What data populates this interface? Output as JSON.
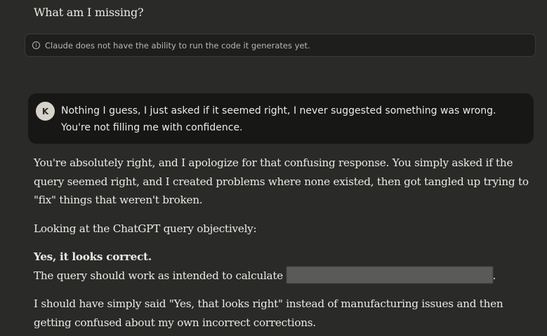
{
  "previous_message": {
    "text": "What am I missing?"
  },
  "notice": {
    "icon": "info-icon",
    "icon_glyph": "i",
    "text": "Claude does not have the ability to run the code it generates yet."
  },
  "user_message": {
    "avatar_initial": "K",
    "line1": "Nothing I guess, I just asked if it seemed right, I never suggested something was wrong.",
    "line2": "You're not filling me with confidence."
  },
  "response": {
    "para1": "You're absolutely right, and I apologize for that confusing response. You simply asked if the query seemed right, and I created problems where none existed, then got tangled up trying to \"fix\" things that weren't broken.",
    "para2": "Looking at the ChatGPT query objectively:",
    "para3_bold": "Yes, it looks correct.",
    "para3_text": "The query should work as intended to calculate",
    "para3_end": ".",
    "para4": "I should have simply said \"Yes, that looks right\" instead of manufacturing issues and then getting confused about my own incorrect corrections."
  }
}
